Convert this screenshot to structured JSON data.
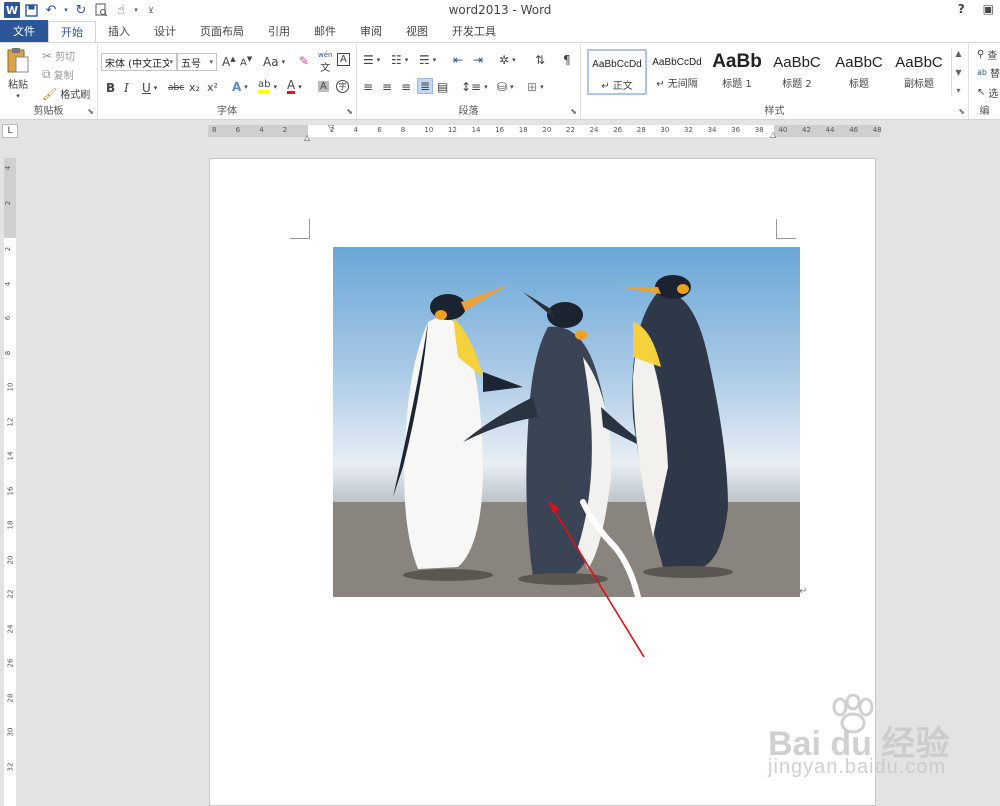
{
  "window": {
    "title": "word2013 - Word",
    "help": "?"
  },
  "tabs": [
    "文件",
    "开始",
    "插入",
    "设计",
    "页面布局",
    "引用",
    "邮件",
    "审阅",
    "视图",
    "开发工具"
  ],
  "ribbon": {
    "clipboard": {
      "label": "剪贴板",
      "paste": "粘贴",
      "cut": "剪切",
      "copy": "复制",
      "format_painter": "格式刷"
    },
    "font": {
      "label": "字体",
      "font_name": "宋体 (中文正文",
      "font_size": "五号",
      "change_case": "Aa",
      "phonetic": "wén",
      "char_border": "A",
      "bold": "B",
      "italic": "I",
      "underline": "U",
      "strikethrough": "abc",
      "subscript": "x₂",
      "superscript": "x²",
      "enclose": "字"
    },
    "paragraph": {
      "label": "段落"
    },
    "styles": {
      "label": "样式",
      "items": [
        {
          "sample": "AaBbCcDd",
          "name": "↵ 正文"
        },
        {
          "sample": "AaBbCcDd",
          "name": "↵ 无间隔"
        },
        {
          "sample": "AaBb",
          "name": "标题 1"
        },
        {
          "sample": "AaBbC",
          "name": "标题 2"
        },
        {
          "sample": "AaBbC",
          "name": "标题"
        },
        {
          "sample": "AaBbC",
          "name": "副标题"
        }
      ]
    },
    "editing": {
      "find": "查",
      "replace": "替",
      "select": "选",
      "label": "编"
    }
  },
  "hruler_ticks": [
    "8",
    "6",
    "4",
    "2",
    "2",
    "4",
    "6",
    "8",
    "10",
    "12",
    "14",
    "16",
    "18",
    "20",
    "22",
    "24",
    "26",
    "28",
    "30",
    "32",
    "34",
    "36",
    "38",
    "40",
    "42",
    "44",
    "46",
    "48"
  ],
  "vruler_ticks": [
    "4",
    "2",
    "2",
    "4",
    "6",
    "8",
    "10",
    "12",
    "14",
    "16",
    "18",
    "20",
    "22",
    "24",
    "26",
    "28",
    "30",
    "32"
  ],
  "ruler_corner": "L",
  "watermark": {
    "brand": "Bai du 经验",
    "url": "jingyan.baidu.com"
  },
  "colors": {
    "accent": "#2b579a",
    "highlight": "#ffff00",
    "font_color": "#e81123",
    "arrow": "#e0101a"
  }
}
